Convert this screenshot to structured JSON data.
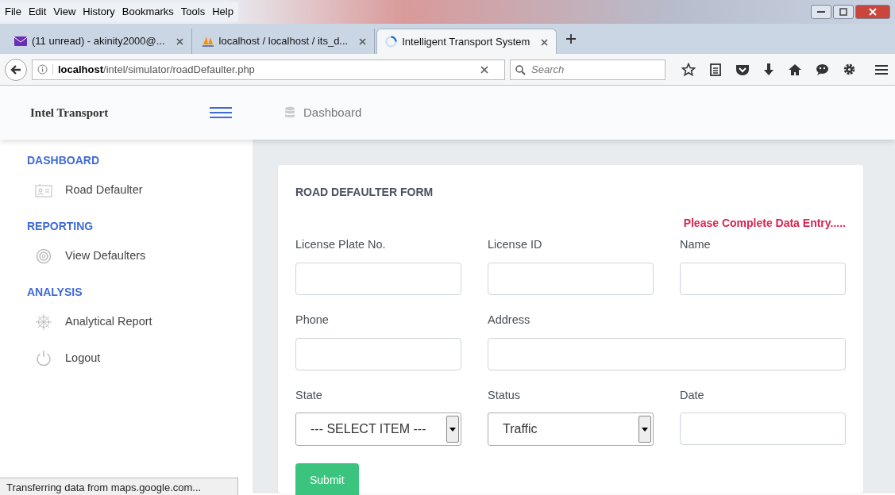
{
  "browser": {
    "menu": [
      "File",
      "Edit",
      "View",
      "History",
      "Bookmarks",
      "Tools",
      "Help"
    ],
    "tabs": [
      {
        "label": "(11 unread) - akinity2000@...",
        "selected": false
      },
      {
        "label": "localhost / localhost / its_d...",
        "selected": false
      },
      {
        "label": "Intelligent Transport System",
        "selected": true
      }
    ],
    "url_host": "localhost",
    "url_path": "/intel/simulator/roadDefaulter.php",
    "search_placeholder": "Search"
  },
  "app": {
    "brand": "Intel Transport",
    "breadcrumb": "Dashboard",
    "sidebar": [
      {
        "heading": "DASHBOARD",
        "items": [
          {
            "label": "Road Defaulter"
          }
        ]
      },
      {
        "heading": "REPORTING",
        "items": [
          {
            "label": "View Defaulters"
          }
        ]
      },
      {
        "heading": "ANALYSIS",
        "items": [
          {
            "label": "Analytical Report"
          },
          {
            "label": "Logout"
          }
        ]
      }
    ],
    "form": {
      "title": "ROAD DEFAULTER FORM",
      "alert": "Please Complete Data Entry.....",
      "fields": [
        {
          "label": "License Plate No.",
          "kind": "text",
          "wide": false
        },
        {
          "label": "License ID",
          "kind": "text",
          "wide": false
        },
        {
          "label": "Name",
          "kind": "text",
          "wide": false
        },
        {
          "label": "Phone",
          "kind": "text",
          "wide": false
        },
        {
          "label": "Address",
          "kind": "text",
          "wide": true
        },
        {
          "label": "State",
          "kind": "select",
          "value": "--- SELECT ITEM ---",
          "wide": false
        },
        {
          "label": "Status",
          "kind": "select",
          "value": "Traffic",
          "wide": false
        },
        {
          "label": "Date",
          "kind": "text",
          "wide": false
        }
      ],
      "submit": "Submit"
    }
  },
  "status_bar": "Transferring data from maps.google.com..."
}
